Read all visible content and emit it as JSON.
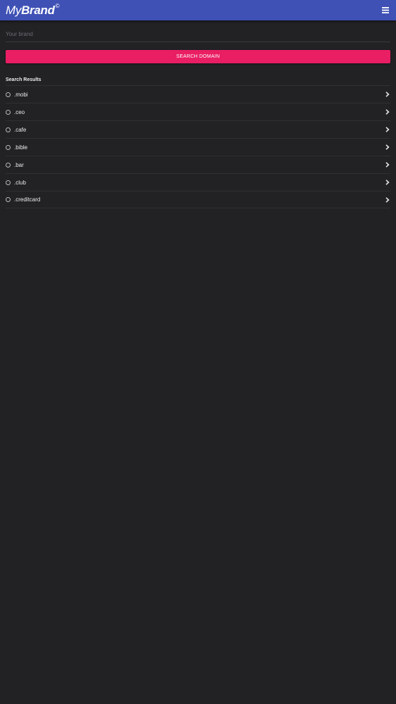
{
  "app_bar": {
    "logo_thin": "My",
    "logo_bold": "Brand",
    "logo_mark": "©",
    "background": "#3f51b5",
    "menu_icon": "hamburger-menu-icon"
  },
  "search": {
    "brand_placeholder": "Your brand",
    "brand_value": "",
    "button_label": "SEARCH DOMAIN",
    "button_color": "#e91e63"
  },
  "results": {
    "title": "Search Results",
    "items": [
      {
        "label": ".mobi"
      },
      {
        "label": ".ceo"
      },
      {
        "label": ".cafe"
      },
      {
        "label": ".bible"
      },
      {
        "label": ".bar"
      },
      {
        "label": ".club"
      },
      {
        "label": ".creditcard"
      }
    ],
    "item_icon": "radio-circle-icon",
    "item_action_icon": "chevron-right-icon"
  },
  "theme": {
    "background": "#222124"
  }
}
